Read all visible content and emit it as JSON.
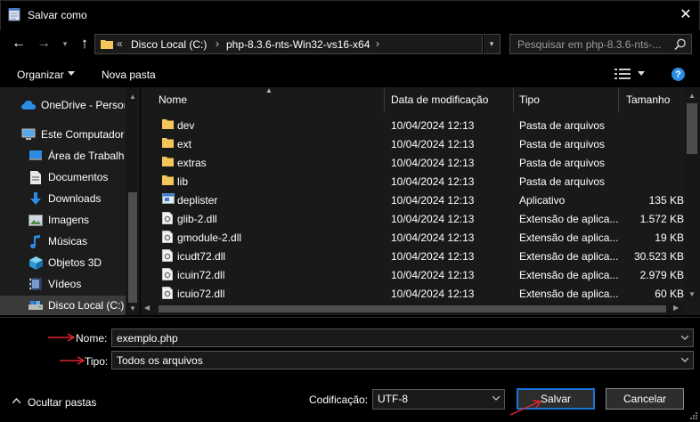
{
  "window": {
    "title": "Salvar como",
    "close_glyph": "✕"
  },
  "nav_buttons": {
    "back": "←",
    "forward": "→",
    "recent": "▾",
    "up": "↑"
  },
  "address": {
    "overflow_chevron": "«",
    "crumbs": [
      "Disco Local (C:)",
      "php-8.3.6-nts-Win32-vs16-x64"
    ],
    "separator": "›"
  },
  "search": {
    "placeholder": "Pesquisar em php-8.3.6-nts-..."
  },
  "toolbar": {
    "organize_label": "Organizar",
    "new_folder_label": "Nova pasta",
    "help_glyph": "?"
  },
  "sidebar": {
    "items": [
      {
        "label": "OneDrive - Persor",
        "icon": "cloud-icon"
      },
      {
        "label": "Este Computador",
        "icon": "computer-icon"
      },
      {
        "label": "Área de Trabalho",
        "icon": "desktop-icon"
      },
      {
        "label": "Documentos",
        "icon": "document-icon"
      },
      {
        "label": "Downloads",
        "icon": "download-icon"
      },
      {
        "label": "Imagens",
        "icon": "image-icon"
      },
      {
        "label": "Músicas",
        "icon": "music-icon"
      },
      {
        "label": "Objetos 3D",
        "icon": "cube-icon"
      },
      {
        "label": "Vídeos",
        "icon": "video-icon"
      },
      {
        "label": "Disco Local (C:)",
        "icon": "drive-icon",
        "selected": true
      }
    ]
  },
  "columns": {
    "name": "Nome",
    "date": "Data de modificação",
    "type": "Tipo",
    "size": "Tamanho"
  },
  "files": [
    {
      "name": "dev",
      "date": "10/04/2024 12:13",
      "type": "Pasta de arquivos",
      "size": "",
      "icon": "folder-icon"
    },
    {
      "name": "ext",
      "date": "10/04/2024 12:13",
      "type": "Pasta de arquivos",
      "size": "",
      "icon": "folder-icon"
    },
    {
      "name": "extras",
      "date": "10/04/2024 12:13",
      "type": "Pasta de arquivos",
      "size": "",
      "icon": "folder-icon"
    },
    {
      "name": "lib",
      "date": "10/04/2024 12:13",
      "type": "Pasta de arquivos",
      "size": "",
      "icon": "folder-icon"
    },
    {
      "name": "deplister",
      "date": "10/04/2024 12:13",
      "type": "Aplicativo",
      "size": "135 KB",
      "icon": "app-icon"
    },
    {
      "name": "glib-2.dll",
      "date": "10/04/2024 12:13",
      "type": "Extensão de aplica...",
      "size": "1.572 KB",
      "icon": "dll-icon"
    },
    {
      "name": "gmodule-2.dll",
      "date": "10/04/2024 12:13",
      "type": "Extensão de aplica...",
      "size": "19 KB",
      "icon": "dll-icon"
    },
    {
      "name": "icudt72.dll",
      "date": "10/04/2024 12:13",
      "type": "Extensão de aplica...",
      "size": "30.523 KB",
      "icon": "dll-icon"
    },
    {
      "name": "icuin72.dll",
      "date": "10/04/2024 12:13",
      "type": "Extensão de aplica...",
      "size": "2.979 KB",
      "icon": "dll-icon"
    },
    {
      "name": "icuio72.dll",
      "date": "10/04/2024 12:13",
      "type": "Extensão de aplica...",
      "size": "60 KB",
      "icon": "dll-icon"
    }
  ],
  "form": {
    "name_label": "Nome:",
    "name_value": "exemplo.php",
    "type_label": "Tipo:",
    "type_value": "Todos os arquivos",
    "hide_folders_label": "Ocultar pastas",
    "encoding_label": "Codificação:",
    "encoding_value": "UTF-8",
    "save_label": "Salvar",
    "cancel_label": "Cancelar"
  },
  "colors": {
    "background": "#000000",
    "pane": "#191919",
    "folder": "#f4c55a",
    "accent": "#1a73d8",
    "annotation_arrow": "#e0262f"
  }
}
